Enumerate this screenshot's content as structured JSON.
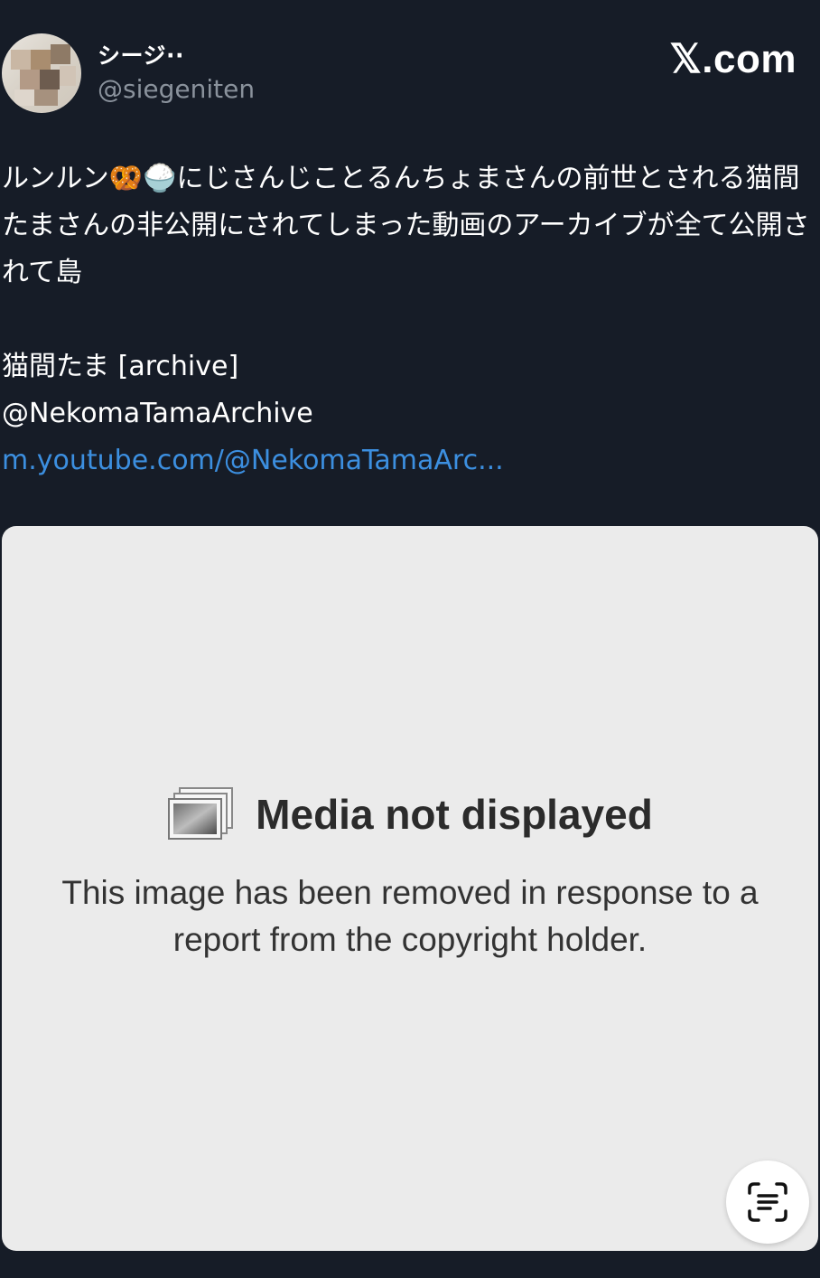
{
  "header": {
    "display_name": "シージ··",
    "handle": "@siegeniten",
    "brand": "𝕏.com"
  },
  "tweet": {
    "line_start": "ルンルン",
    "emoji_1": "🥨",
    "emoji_2": "🍚",
    "text_rest": "にじさんじことるんちょまさんの前世とされる猫間たまさんの非公開にされてしまった動画のアーカイブが全て公開されて島",
    "account_name": "猫間たま [archive]",
    "account_handle": "@NekomaTamaArchive",
    "link": "m.youtube.com/@NekomaTamaArc..."
  },
  "media": {
    "title": "Media not displayed",
    "description": "This image has been removed in response to a report from the copyright holder."
  },
  "icons": {
    "avatar": "avatar-image",
    "media": "stacked-image-icon",
    "scan": "live-text-scan-icon"
  }
}
